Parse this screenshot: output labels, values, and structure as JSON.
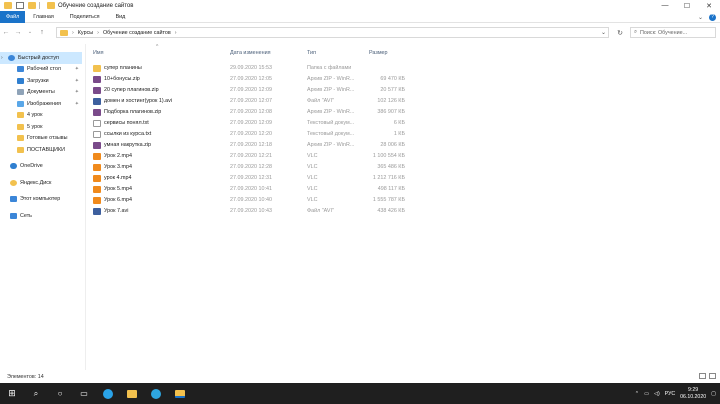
{
  "window": {
    "title": "Обучение создание сайтов"
  },
  "ribbon": {
    "file": "Файл",
    "tabs": [
      "Главная",
      "Поделиться",
      "Вид"
    ]
  },
  "address": {
    "path": [
      "Курсы",
      "Обучение создание сайтов"
    ],
    "search_placeholder": "Поиск: Обучение..."
  },
  "sidebar": {
    "quick_access": "Быстрый доступ",
    "items": [
      {
        "label": "Рабочий стол",
        "pinned": true
      },
      {
        "label": "Загрузки",
        "pinned": true
      },
      {
        "label": "Документы",
        "pinned": true
      },
      {
        "label": "Изображения",
        "pinned": true
      },
      {
        "label": "4 урок",
        "pinned": false
      },
      {
        "label": "5 урок",
        "pinned": false
      },
      {
        "label": "Готовые отзывы",
        "pinned": false
      },
      {
        "label": "ПОСТАВЩИКИ",
        "pinned": false
      }
    ],
    "onedrive": "OneDrive",
    "yandex": "Яндекс.Диск",
    "this_pc": "Этот компьютер",
    "network": "Сеть"
  },
  "columns": {
    "name": "Имя",
    "date": "Дата изменения",
    "type": "Тип",
    "size": "Размер"
  },
  "files": [
    {
      "name": "супер планины",
      "date": "29.09.2020 15:53",
      "type": "Папка с файлами",
      "size": "",
      "icon": "folder"
    },
    {
      "name": "10+бонусы.zip",
      "date": "27.09.2020 12:05",
      "type": "Архив ZIP - WinR...",
      "size": "69 470 КБ",
      "icon": "archive"
    },
    {
      "name": "20 супер плагинов.zip",
      "date": "27.09.2020 12:09",
      "type": "Архив ZIP - WinR...",
      "size": "20 577 КБ",
      "icon": "archive"
    },
    {
      "name": "домен и хостинг(урок 1).avi",
      "date": "27.09.2020 12:07",
      "type": "Файл \"AVI\"",
      "size": "102 126 КБ",
      "icon": "video"
    },
    {
      "name": "Подборка плагинов.zip",
      "date": "27.09.2020 12:08",
      "type": "Архив ZIP - WinR...",
      "size": "386 907 КБ",
      "icon": "archive"
    },
    {
      "name": "сервисы понял.txt",
      "date": "27.09.2020 12:09",
      "type": "Текстовый докум...",
      "size": "6 КБ",
      "icon": "text"
    },
    {
      "name": "ссылки из курса.txt",
      "date": "27.09.2020 12:20",
      "type": "Текстовый докум...",
      "size": "1 КБ",
      "icon": "text"
    },
    {
      "name": "умная накрутка.zip",
      "date": "27.09.2020 12:18",
      "type": "Архив ZIP - WinR...",
      "size": "28 006 КБ",
      "icon": "archive"
    },
    {
      "name": "Урок 2.mp4",
      "date": "27.09.2020 12:21",
      "type": "VLC",
      "size": "1 100 554 КБ",
      "icon": "vlc"
    },
    {
      "name": "Урок 3.mp4",
      "date": "27.09.2020 12:28",
      "type": "VLC",
      "size": "365 486 КБ",
      "icon": "vlc"
    },
    {
      "name": "урок 4.mp4",
      "date": "27.09.2020 12:31",
      "type": "VLC",
      "size": "1 212 716 КБ",
      "icon": "vlc"
    },
    {
      "name": "Урок 5.mp4",
      "date": "27.09.2020 10:41",
      "type": "VLC",
      "size": "498 117 КБ",
      "icon": "vlc"
    },
    {
      "name": "Урок 6.mp4",
      "date": "27.09.2020 10:40",
      "type": "VLC",
      "size": "1 555 787 КБ",
      "icon": "vlc"
    },
    {
      "name": "Урок 7.avi",
      "date": "27.09.2020 10:43",
      "type": "Файл \"AVI\"",
      "size": "438 426 КБ",
      "icon": "video"
    }
  ],
  "status": {
    "count": "Элементов: 14"
  },
  "tray": {
    "lang": "РУС",
    "time": "9:29",
    "date": "06.10.2020"
  },
  "colors": {
    "accent": "#1a73c9",
    "folder": "#f2c14e",
    "selection": "#cce8ff",
    "taskbar": "#1f1f1f"
  }
}
